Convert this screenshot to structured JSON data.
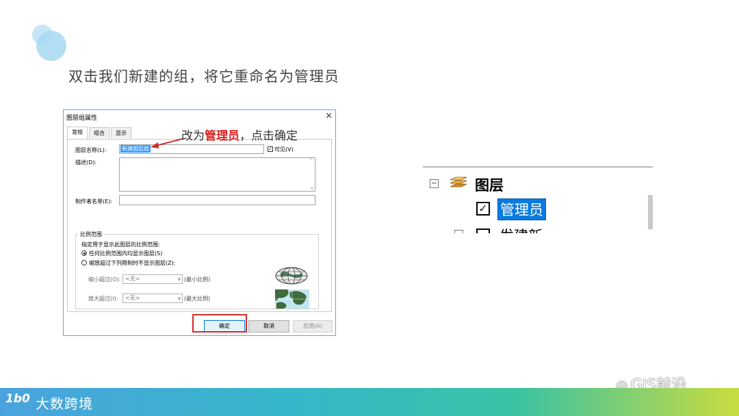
{
  "slide": {
    "title": "双击我们新建的组，将它重命名为管理员",
    "annotation_prefix": "改为",
    "annotation_highlight": "管理员",
    "annotation_suffix": "，点击确定"
  },
  "dialog": {
    "title": "图层组属性",
    "close": "×",
    "tabs": [
      {
        "label": "常规",
        "active": true
      },
      {
        "label": "组合",
        "active": false
      },
      {
        "label": "显示",
        "active": false
      }
    ],
    "layer_name_label": "图层名称(L):",
    "layer_name_value": "新建图层组",
    "visible_label": "可见(V)",
    "visible_checked": true,
    "description_label": "描述(D):",
    "credits_label": "制作者名单(E):",
    "scale_group_title": "比例范围",
    "scale_prompt": "指定用于显示此图层的比例范围:",
    "radio_all": "任何比例范围内均显示图层(S)",
    "radio_range": "缩放超过下列限制时不显示图层(Z):",
    "zoom_out_label": "缩小超过(O):",
    "zoom_out_value": "<无>",
    "zoom_out_hint": "(最小比例)",
    "zoom_in_label": "放大超过(I):",
    "zoom_in_value": "<无>",
    "zoom_in_hint": "(最大比例)",
    "buttons": {
      "ok": "确定",
      "cancel": "取消",
      "apply": "应用(A)"
    },
    "scroll_up": "^",
    "scroll_down": "v",
    "combo_arrow": "v"
  },
  "tree": {
    "expander": "−",
    "root_label": "图层",
    "selected_item": "管理员",
    "selected_checked": true,
    "next_item_partial": "发建新"
  },
  "footer": {
    "brand": "大数跨境",
    "brand_mark": "1b0",
    "watermark": "GIS前沿"
  },
  "colors": {
    "accent_red": "#e02222",
    "selection_blue": "#0a7be0",
    "highlight_blue": "#3399ff"
  }
}
